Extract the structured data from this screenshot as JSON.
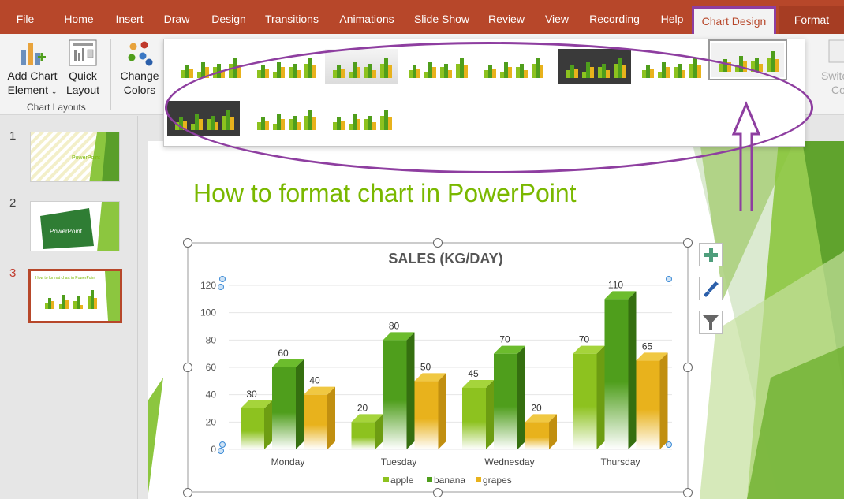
{
  "ribbon_tabs": [
    {
      "label": "File"
    },
    {
      "label": "Home"
    },
    {
      "label": "Insert"
    },
    {
      "label": "Draw"
    },
    {
      "label": "Design"
    },
    {
      "label": "Transitions"
    },
    {
      "label": "Animations"
    },
    {
      "label": "Slide Show"
    },
    {
      "label": "Review"
    },
    {
      "label": "View"
    },
    {
      "label": "Recording"
    },
    {
      "label": "Help"
    },
    {
      "label": "Chart Design"
    },
    {
      "label": "Format"
    }
  ],
  "ribbon": {
    "add_chart_element_l1": "Add Chart",
    "add_chart_element_l2": "Element",
    "quick_layout_l1": "Quick",
    "quick_layout_l2": "Layout",
    "change_colors_l1": "Change",
    "change_colors_l2": "Colors",
    "group_chart_layouts": "Chart Layouts",
    "switch_row_col_l1": "Switc",
    "switch_row_col_l2": "Co"
  },
  "slides": [
    {
      "number": "1",
      "title": "PowerPoint"
    },
    {
      "number": "2",
      "title": "PowerPoint"
    },
    {
      "number": "3",
      "title": "How to format chart in PowerPoint"
    }
  ],
  "slide": {
    "title": "How to format chart in PowerPoint"
  },
  "colors": {
    "accent": "#b7472a",
    "highlight": "#8e3ea0",
    "apple": "#8dc21f",
    "banana": "#4f9e1c",
    "grapes": "#e8b21c",
    "title_green": "#7ab800"
  },
  "chart_data": {
    "type": "bar",
    "title": "SALES (KG/DAY)",
    "categories": [
      "Monday",
      "Tuesday",
      "Wednesday",
      "Thursday"
    ],
    "series": [
      {
        "name": "apple",
        "values": [
          30,
          20,
          45,
          70
        ]
      },
      {
        "name": "banana",
        "values": [
          60,
          80,
          70,
          110
        ]
      },
      {
        "name": "grapes",
        "values": [
          40,
          50,
          20,
          65
        ]
      }
    ],
    "ylim": [
      0,
      120
    ],
    "yticks": [
      "0",
      "20",
      "40",
      "60",
      "80",
      "100",
      "120"
    ],
    "legend": "bottom",
    "grid": true
  }
}
